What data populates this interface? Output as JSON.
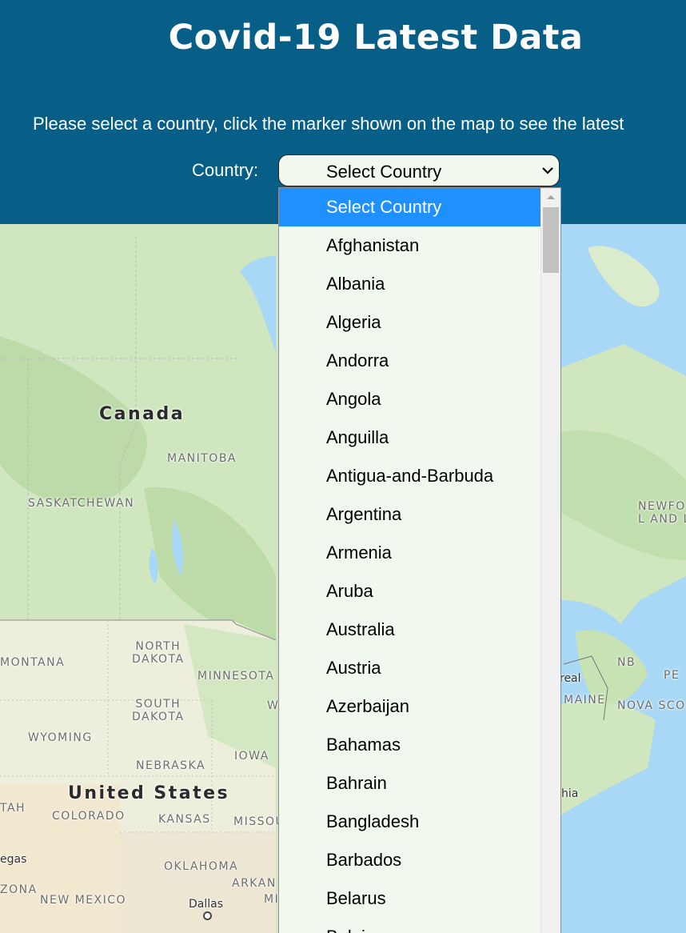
{
  "header": {
    "title": "Covid-19 Latest Data",
    "instructions": "Please select a country, click the marker shown on the map to see the latest"
  },
  "form": {
    "country_label": "Country:",
    "selected_value": "Select Country"
  },
  "dropdown": {
    "options": [
      "Select Country",
      "Afghanistan",
      "Albania",
      "Algeria",
      "Andorra",
      "Angola",
      "Anguilla",
      "Antigua-and-Barbuda",
      "Argentina",
      "Armenia",
      "Aruba",
      "Australia",
      "Austria",
      "Azerbaijan",
      "Bahamas",
      "Bahrain",
      "Bangladesh",
      "Barbados",
      "Belarus",
      "Belgium"
    ],
    "selected_index": 0
  },
  "map": {
    "labels": {
      "canada": "Canada",
      "manitoba": "MANITOBA",
      "saskatchewan": "SASKATCHEWAN",
      "newfoundland": "NEWFO\nL AND L",
      "north_dakota": "NORTH\nDAKOTA",
      "montana": "MONTANA",
      "minnesota": "MINNESOTA",
      "nb": "NB",
      "pe": "PE",
      "real": "real",
      "maine": "MAINE",
      "nova_scotia": "NOVA SCO",
      "south_dakota": "SOUTH\nDAKOTA",
      "w": "W",
      "wyoming": "WYOMING",
      "iowa": "IOWA",
      "nebraska": "NEBRASKA",
      "united_states": "United States",
      "utah": "TAH",
      "colorado": "COLORADO",
      "kansas": "KANSAS",
      "missouri": "MISSOU",
      "hia": "hia",
      "egas": "egas",
      "oklahoma": "OKLAHOMA",
      "arkansas": "ARKAN",
      "mi": "MI",
      "arizona": "ZONA",
      "new_mexico": "NEW MEXICO",
      "dallas": "Dallas"
    }
  },
  "colors": {
    "header_bg": "#075f88",
    "dropdown_bg": "#f1f9ee",
    "selected_option_bg": "#1e90ff",
    "water": "#a8d8f5"
  }
}
